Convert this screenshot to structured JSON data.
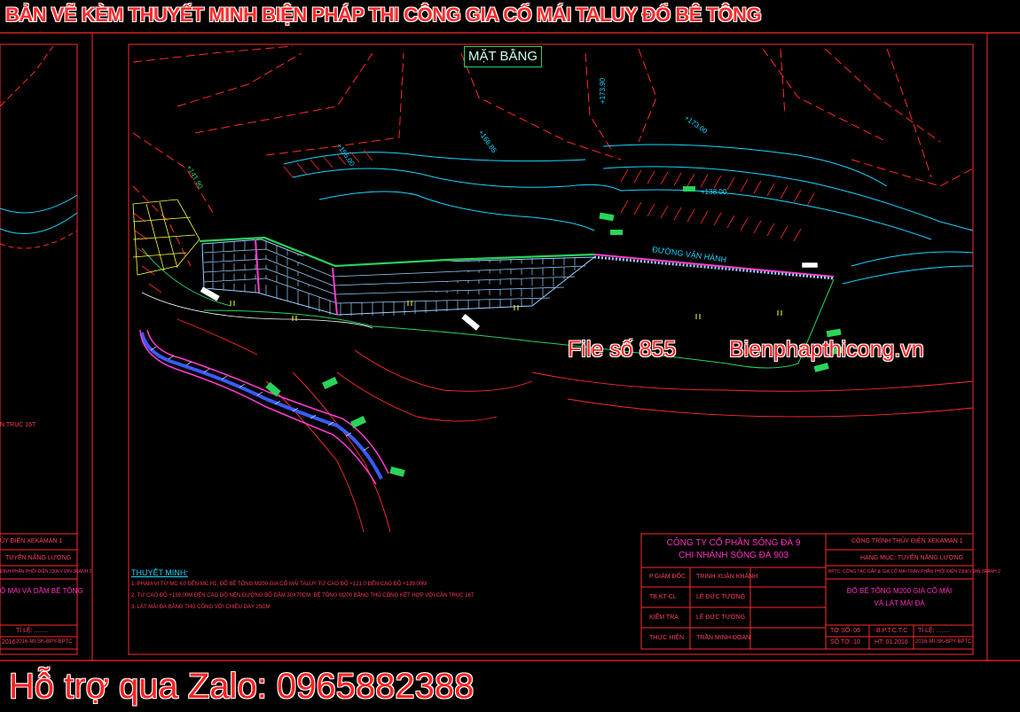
{
  "banner": "BẢN VẼ KÈM THUYẾT MINH BIỆN PHÁP THI CÔNG GIA CỐ MÁI TALUY ĐỔ BÊ TÔNG",
  "sheet_title": "MẶT BẰNG",
  "watermark": {
    "file": "File số 855",
    "site": "Bienphapthicong.vn"
  },
  "zalo": "Hỗ trợ qua Zalo: 0965882388",
  "road_label": "ĐƯỜNG VẬN HÀNH",
  "stations": [
    "+141.90",
    "+155.00",
    "+166.85",
    "+173.90",
    "+173.00",
    "+138.00"
  ],
  "notes": {
    "heading": "THUYẾT MINH:",
    "lines": [
      "1. PHẠM VI TỪ MC K0 ĐẾN MC H1, ĐỔ BÊ TÔNG M200 GIA CỐ MÁI TALUY TỪ CAO ĐỘ +121.0 ĐẾN CAO ĐỘ +139.00M",
      "2. TỪ CAO ĐỘ +139.00M ĐẾN CAO ĐỘ NỀN ĐƯỜNG BỐ DẦM 30X70CM, BÊ TÔNG M200 BẰNG THỦ CÔNG KẾT HỢP VỚI CẦN TRỤC 16T",
      "3. LÁT MÁI ĐÁ BẰNG THỦ CÔNG VỚI CHIỀU DÀY 25CM"
    ]
  },
  "title_block": {
    "company_1": "CÔNG TY CỔ PHẦN SÔNG ĐÀ 9",
    "company_2": "CHI NHÁNH SÔNG ĐÀ 903",
    "rows": [
      {
        "role": "P.GIÁM ĐỐC",
        "name": "TRỊNH XUÂN KHÁNH"
      },
      {
        "role": "TB.KT-CL",
        "name": "LÊ ĐỨC TƯỜNG"
      },
      {
        "role": "KIỂM TRA",
        "name": "LÊ ĐỨC TƯỜNG"
      },
      {
        "role": "THỰC HIỆN",
        "name": "TRẦN MINH ĐOAN"
      }
    ],
    "project": "CÔNG TRÌNH THỦY ĐIỆN XEKAMAN 1",
    "category": "HẠNG MỤC: TUYẾN NĂNG LƯỢNG",
    "subcategory": "BPTC: CÔNG TÁC GẮP & GIA CỐ MÁI TRÀN PHẦN PHỐI ĐIỆN 230KV ĐIN 3RANH 2",
    "drawing_1": "ĐỔ BÊ TÔNG M200 GIA CỐ MÁI",
    "drawing_2": "VÀ LÁT MÁI ĐÁ",
    "to_so": "TỜ SỐ: 06",
    "so_to": "SỐ TỜ: 10",
    "bptc": "B.P.T.C.T.C",
    "ty_le": "TỈ LỆ: ........",
    "date": "HT: 01.2016",
    "code": "2016-MI-SK-BPY-BPTC"
  },
  "left_sheet": {
    "project": "ỦY ĐIỆN XEKAMAN 1",
    "category": "TUYẾN NĂNG LƯỢNG",
    "subcategory": "ĐÌNH PHÂN PHỐI ĐIỆN 230KV ĐIN 3RANH 2",
    "drawing": "Ô MÁI VÀ DẦM BÊ TÔNG",
    "scale": "TỈ LỆ: ........",
    "code": "2016-MI-SK-BPY-BPTC",
    "date": "2016",
    "note": "N TRỤC 16T"
  },
  "colors": {
    "banner": "#ff2a2a",
    "frame": "#ff2a2a",
    "contour": "#19d6ff",
    "slope": "#ff3bd0",
    "green": "#2ad35a"
  }
}
